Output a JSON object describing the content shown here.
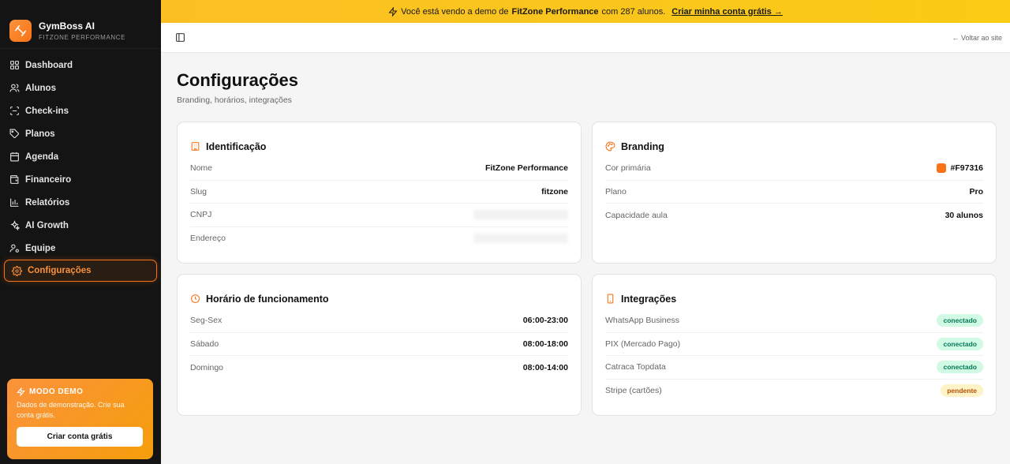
{
  "app": {
    "name": "GymBoss AI",
    "tenant": "FITZONE PERFORMANCE"
  },
  "banner": {
    "prefix": "Você está vendo a demo de",
    "gym": "FitZone Performance",
    "suffix": "com 287 alunos.",
    "cta": "Criar minha conta grátis →"
  },
  "sidebar": {
    "items": [
      {
        "label": "Dashboard",
        "icon": "grid-icon"
      },
      {
        "label": "Alunos",
        "icon": "users-icon"
      },
      {
        "label": "Check-ins",
        "icon": "scan-icon"
      },
      {
        "label": "Planos",
        "icon": "tag-icon"
      },
      {
        "label": "Agenda",
        "icon": "calendar-icon"
      },
      {
        "label": "Financeiro",
        "icon": "wallet-icon"
      },
      {
        "label": "Relatórios",
        "icon": "bar-chart-icon"
      },
      {
        "label": "AI Growth",
        "icon": "sparkles-icon"
      },
      {
        "label": "Equipe",
        "icon": "user-cog-icon"
      },
      {
        "label": "Configurações",
        "icon": "gear-icon",
        "active": true
      }
    ],
    "demo": {
      "title": "MODO DEMO",
      "text": "Dados de demonstração. Crie sua conta grátis.",
      "button": "Criar conta grátis"
    }
  },
  "topbar": {
    "back": "← Voltar ao site"
  },
  "page": {
    "title": "Configurações",
    "subtitle": "Branding, horários, integrações"
  },
  "identificacao": {
    "title": "Identificação",
    "rows": [
      {
        "label": "Nome",
        "value": "FitZone Performance"
      },
      {
        "label": "Slug",
        "value": "fitzone"
      },
      {
        "label": "CNPJ",
        "value": ""
      },
      {
        "label": "Endereço",
        "value": ""
      }
    ]
  },
  "branding": {
    "title": "Branding",
    "color_label": "Cor primária",
    "color_value": "#F97316",
    "plan_label": "Plano",
    "plan_value": "Pro",
    "capacity_label": "Capacidade aula",
    "capacity_value": "30 alunos"
  },
  "horario": {
    "title": "Horário de funcionamento",
    "rows": [
      {
        "label": "Seg-Sex",
        "value": "06:00-23:00"
      },
      {
        "label": "Sábado",
        "value": "08:00-18:00"
      },
      {
        "label": "Domingo",
        "value": "08:00-14:00"
      }
    ]
  },
  "integracoes": {
    "title": "Integrações",
    "rows": [
      {
        "label": "WhatsApp Business",
        "status": "conectado"
      },
      {
        "label": "PIX (Mercado Pago)",
        "status": "conectado"
      },
      {
        "label": "Catraca Topdata",
        "status": "conectado"
      },
      {
        "label": "Stripe (cartões)",
        "status": "pendente"
      }
    ]
  },
  "colors": {
    "accent": "#F97316",
    "sidebar_bg": "#141414",
    "banner": "#FBBF24"
  }
}
